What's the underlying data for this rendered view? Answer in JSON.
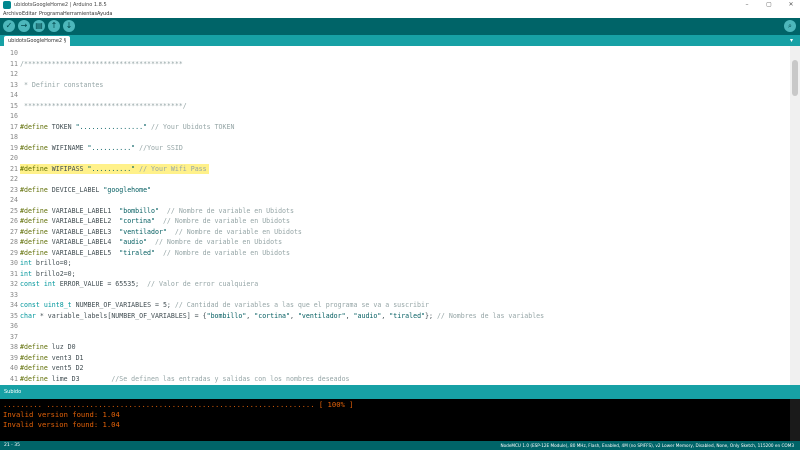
{
  "window": {
    "title": "ubidotsGoogleHome2 | Arduino 1.8.5",
    "minimize": "–",
    "maximize": "▢",
    "close": "✕"
  },
  "menu": [
    "Archivo",
    "Editar",
    "Programa",
    "Herramientas",
    "Ayuda"
  ],
  "toolbar": {
    "verify_icon": "✓",
    "upload_icon": "→",
    "new_icon": "▤",
    "open_icon": "↑",
    "save_icon": "↓",
    "serial_monitor_icon": "⌕"
  },
  "tab": {
    "name": "ubidotsGoogleHome2 §",
    "menu_icon": "▾"
  },
  "code": {
    "line_numbers": [
      "10",
      "11",
      "12",
      "13",
      "14",
      "15",
      "16",
      "17",
      "18",
      "19",
      "20",
      "21",
      "22",
      "23",
      "24",
      "25",
      "26",
      "27",
      "28",
      "29",
      "30",
      "31",
      "32",
      "33",
      "34",
      "35",
      "36",
      "37",
      "38",
      "39",
      "40",
      "41"
    ],
    "lines": [
      "",
      "/****************************************",
      "",
      " * Definir constantes",
      "",
      " ****************************************/",
      "",
      "#define TOKEN \"................\" // Your Ubidots TOKEN",
      "",
      "#define WIFINAME \"..........\" //Your SSID",
      "",
      "#define WIFIPASS \"..........\" // Your Wifi Pass",
      "",
      "#define DEVICE_LABEL \"googlehome\"",
      "",
      "#define VARIABLE_LABEL1  \"bombillo\"  // Nombre de variable en Ubidots",
      "#define VARIABLE_LABEL2  \"cortina\"  // Nombre de variable en Ubidots",
      "#define VARIABLE_LABEL3  \"ventilador\"  // Nombre de variable en Ubidots",
      "#define VARIABLE_LABEL4  \"audio\"  // Nombre de variable en Ubidots",
      "#define VARIABLE_LABEL5  \"tiraled\"  // Nombre de variable en Ubidots",
      "int brillo=0;",
      "int brillo2=0;",
      "const int ERROR_VALUE = 65535;  // Valor de error cualquiera",
      "",
      "const uint8_t NUMBER_OF_VARIABLES = 5; // Cantidad de variables a las que el programa se va a suscribir",
      "char * variable_labels[NUMBER_OF_VARIABLES] = {\"bombillo\", \"cortina\", \"ventilador\", \"audio\", \"tiraled\"}; // Nombres de las variables",
      "",
      "",
      "#define luz D0",
      "#define vent3 D1",
      "#define vent5 D2",
      "#define lime D3        //Se definen las entradas y salidas con los nombres deseados"
    ]
  },
  "status": {
    "text": "Subido"
  },
  "console": {
    "lines": [
      "......... .............................................................. [ 100% ]",
      "Invalid version found: 1.04",
      "Invalid version found: 1.04"
    ]
  },
  "footer": {
    "position": "21 - 35",
    "board": "NodeMCU 1.0 (ESP-12E Module), 80 MHz, Flash, Enabled, 4M (no SPIFFS), v2 Lower Memory, Disabled, None, Only Sketch, 115200 en COM3"
  },
  "colors": {
    "toolbar": "#006468",
    "tabbar": "#17a1a5",
    "highlight": "#fff18a",
    "console_text": "#e36209"
  }
}
